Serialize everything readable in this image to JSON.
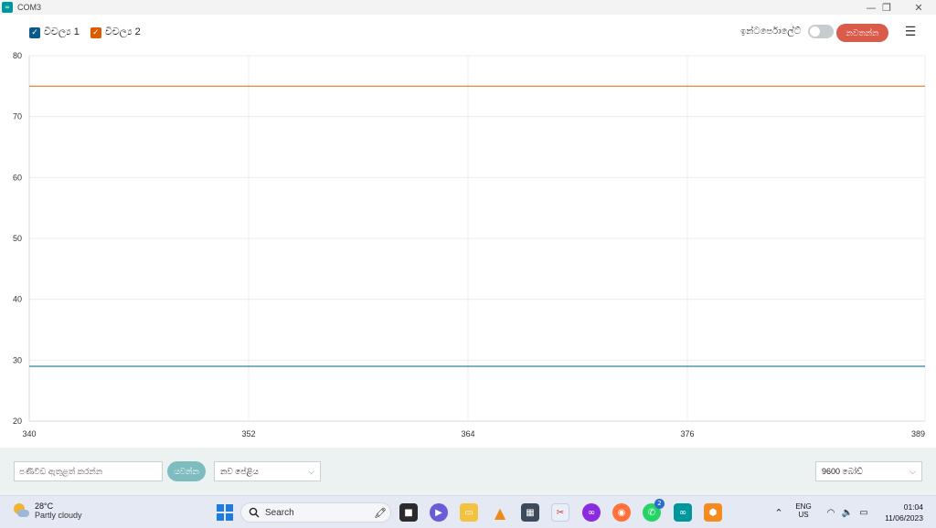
{
  "window": {
    "title": "COM3",
    "app_logo": "∞",
    "minimize": "—",
    "maximize": "❐",
    "close": "✕"
  },
  "legend": {
    "series": [
      {
        "label": "විචල්‍ය 1",
        "color": "#0a5b8c",
        "checked": true
      },
      {
        "label": "විචල්‍ය 2",
        "color": "#e05a00",
        "checked": true
      }
    ]
  },
  "toolbar": {
    "interpolate_label": "ඉන්ටර්පොලේට්",
    "interpolate_on": false,
    "stop_label": "නවතන්න",
    "menu_icon": "list-menu-icon"
  },
  "chart_data": {
    "type": "line",
    "title": "",
    "xlabel": "",
    "ylabel": "",
    "xlim": [
      340,
      389
    ],
    "ylim": [
      20,
      80
    ],
    "xticks": [
      340,
      352,
      364,
      376,
      389
    ],
    "yticks": [
      20,
      30,
      40,
      50,
      60,
      70,
      80
    ],
    "grid": true,
    "series": [
      {
        "name": "විචල්‍ය 1",
        "color": "#2e7ea6",
        "x": [
          340,
          389
        ],
        "y": [
          29,
          29
        ]
      },
      {
        "name": "විචල්‍ය 2",
        "color": "#e07a20",
        "x": [
          340,
          389
        ],
        "y": [
          75,
          75
        ]
      }
    ]
  },
  "bottom": {
    "message_placeholder": "පණිවිඩ ඇතුළත් කරන්න",
    "send_label": "යවන්න",
    "line_ending": "නව පේළිය",
    "baud_rate": "9600 බෝඩ්"
  },
  "taskbar": {
    "weather_temp": "28°C",
    "weather_desc": "Partly cloudy",
    "search_label": "Search",
    "whatsapp_badge": "2",
    "lang_top": "ENG",
    "lang_bottom": "US",
    "time": "01:04",
    "date": "11/06/2023"
  }
}
